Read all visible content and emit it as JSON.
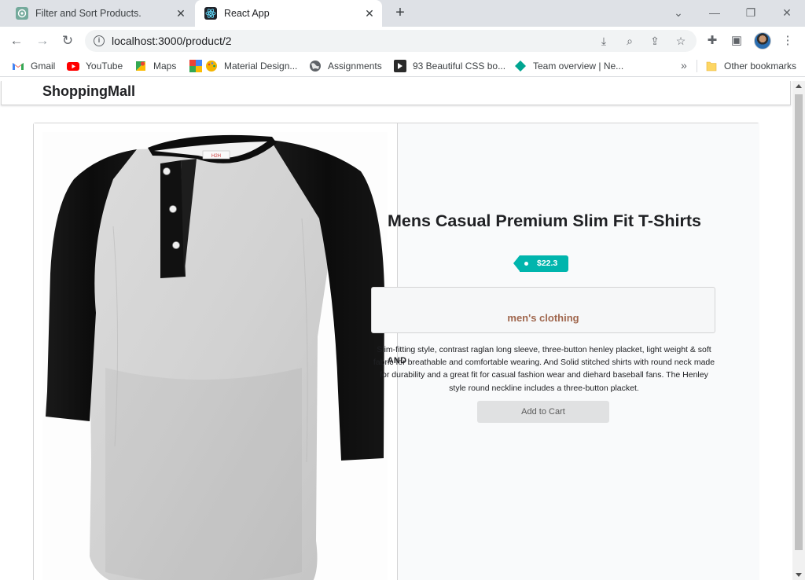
{
  "browser": {
    "tabs": [
      {
        "title": "Filter and Sort Products.",
        "icon": "chatgpt-icon",
        "active": false
      },
      {
        "title": "React App",
        "icon": "react-icon",
        "active": true
      }
    ],
    "url": "localhost:3000/product/2",
    "bookmarks": [
      {
        "label": "Gmail",
        "icon": "gmail-icon"
      },
      {
        "label": "YouTube",
        "icon": "youtube-icon"
      },
      {
        "label": "Maps",
        "icon": "maps-icon"
      },
      {
        "label": "Material Design...",
        "icon": "material-design-icon"
      },
      {
        "label": "Assignments",
        "icon": "globe-icon"
      },
      {
        "label": "93 Beautiful CSS bo...",
        "icon": "css-icon"
      },
      {
        "label": "Team overview | Ne...",
        "icon": "diamond-icon"
      }
    ],
    "more_bookmarks_label": "»",
    "other_bookmarks": "Other bookmarks"
  },
  "site": {
    "brand": "ShoppingMall"
  },
  "product": {
    "title": "Mens Casual Premium Slim Fit T-Shirts",
    "price": "$22.3",
    "divider": "AND",
    "category": "men's clothing",
    "description": "Slim-fitting style, contrast raglan long sleeve, three-button henley placket, light weight & soft fabric for breathable and comfortable wearing. And Solid stitched shirts with round neck made for durability and a great fit for casual fashion wear and diehard baseball fans. The Henley style round neckline includes a three-button placket.",
    "add_to_cart": "Add to Cart",
    "image_tag": "H2H"
  },
  "colors": {
    "price_tag": "#00b5ad",
    "category_text": "#a0674e",
    "tab_strip": "#dee1e6"
  }
}
